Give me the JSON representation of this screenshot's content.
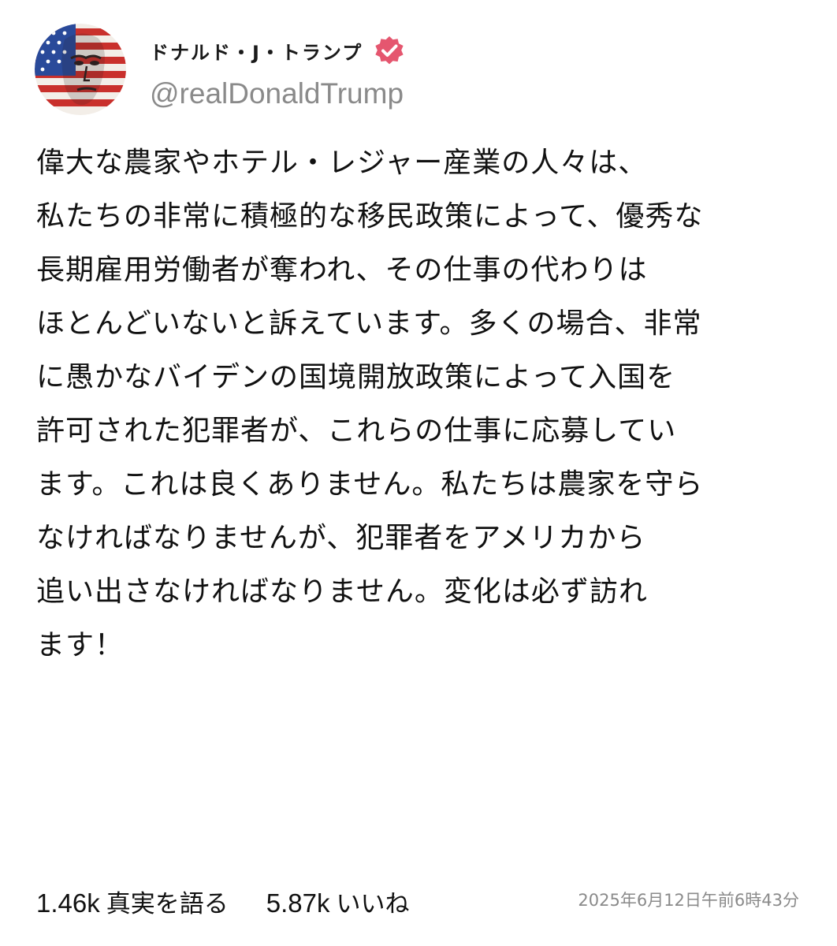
{
  "author": {
    "display_name": "ドナルド・J・トランプ",
    "handle": "@realDonaldTrump",
    "verified": true,
    "verified_color": "#e5566f",
    "avatar_icon": "flag-portrait-avatar"
  },
  "post": {
    "lines": [
      "偉大な農家やホテル・レジャー産業の人々は、",
      "私たちの非常に積極的な移民政策によって、優秀な",
      "長期雇用労働者が奪われ、その仕事の代わりは",
      "ほとんどいないと訴えています。多くの場合、非常",
      "に愚かなバイデンの国境開放政策によって入国を",
      "許可された犯罪者が、これらの仕事に応募してい",
      "ます。これは良くありません。私たちは農家を守ら",
      "なければなりませんが、犯罪者をアメリカから",
      "追い出さなければなりません。変化は必ず訪れ",
      "ます！"
    ]
  },
  "stats": {
    "retruths_count": "1.46k",
    "retruths_label": "真実を語る",
    "likes_count": "5.87k",
    "likes_label": "いいね"
  },
  "timestamp": "2025年6月12日午前6時43分",
  "colors": {
    "text": "#111111",
    "muted": "#8a8a8a",
    "background": "#ffffff"
  }
}
